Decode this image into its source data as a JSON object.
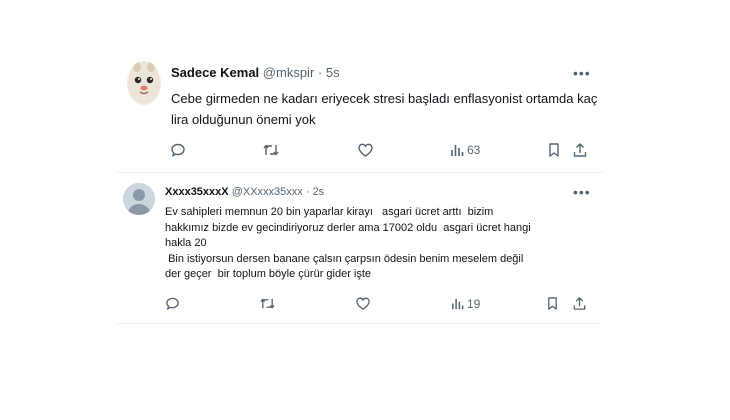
{
  "tweets": [
    {
      "name": "Sadece Kemal",
      "handle": "@mkspir",
      "dot": "·",
      "time": "5s",
      "more": "•••",
      "text": "Cebe girmeden ne kadarı eriyecek stresi başladı enflasyonist ortamda kaç\nlira olduğunun önemi yok",
      "views": "63",
      "icons": [
        "reply-icon",
        "retweet-icon",
        "like-icon",
        "views-icon",
        "bookmark-icon",
        "share-icon"
      ]
    },
    {
      "name": "Xxxx35xxxX",
      "handle": "@XXxxx35xxx",
      "dot": "·",
      "time": "2s",
      "more": "•••",
      "text": "Ev sahipleri memnun 20 bin yaparlar kirayı   asgari ücret arttı  bizim\nhakkımız bizde ev gecindiriyoruz derler ama 17002 oldu  asgari ücret hangi\nhakla 20\n Bin istiyorsun dersen banane çalsın çarpsın ödesin benim meselem değil\nder geçer  bir toplum böyle çürür gider işte",
      "views": "19",
      "icons": [
        "reply-icon",
        "retweet-icon",
        "like-icon",
        "views-icon",
        "bookmark-icon",
        "share-icon"
      ]
    }
  ],
  "colors": {
    "text": "#0f1419",
    "muted": "#536471",
    "divider": "#eff3f4",
    "avatar_default": "#9aa3ad"
  }
}
